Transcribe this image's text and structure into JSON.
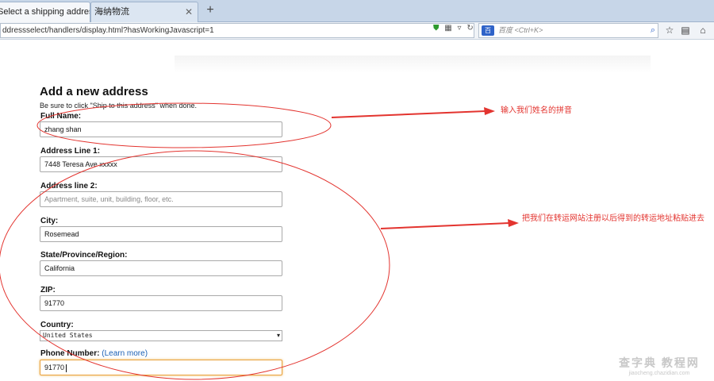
{
  "browser": {
    "tabs": [
      {
        "label": "Select a shipping address",
        "active": true
      },
      {
        "label": "海纳物流",
        "active": false
      }
    ],
    "new_tab": "+",
    "url": "ddressselect/handlers/display.html?hasWorkingJavascript=1",
    "search": {
      "engine": "百",
      "placeholder": "百度 <Ctrl+K>"
    },
    "icons": [
      "shield-icon",
      "grid-icon",
      "dropdown-icon",
      "reload-icon",
      "search-icon",
      "star-icon",
      "bookmarks-icon",
      "home-icon"
    ]
  },
  "form": {
    "title": "Add a new address",
    "subtitle": "Be sure to click \"Ship to this address\" when done.",
    "full_name": {
      "label": "Full Name:",
      "value": "zhang shan"
    },
    "address1": {
      "label": "Address Line 1:",
      "value": "7448 Teresa Ave xxxxx"
    },
    "address2": {
      "label": "Address line 2:",
      "placeholder": "Apartment, suite, unit, building, floor, etc."
    },
    "city": {
      "label": "City:",
      "value": "Rosemead"
    },
    "state": {
      "label": "State/Province/Region:",
      "value": "California"
    },
    "zip": {
      "label": "ZIP:",
      "value": "91770"
    },
    "country": {
      "label": "Country:",
      "value": "United States"
    },
    "phone": {
      "label": "Phone Number:",
      "learn_more": "(Learn more)",
      "value": "91770"
    }
  },
  "annotations": {
    "name": "输入我们姓名的拼音",
    "address": "把我们在转运网站注册以后得到的转运地址粘贴进去"
  },
  "colors": {
    "annotation": "#e3342f",
    "link": "#1a5fb4",
    "focus": "#e9a13b"
  },
  "watermark": {
    "main": "查字典 教程网",
    "sub": "jiaocheng.chazidian.com"
  }
}
